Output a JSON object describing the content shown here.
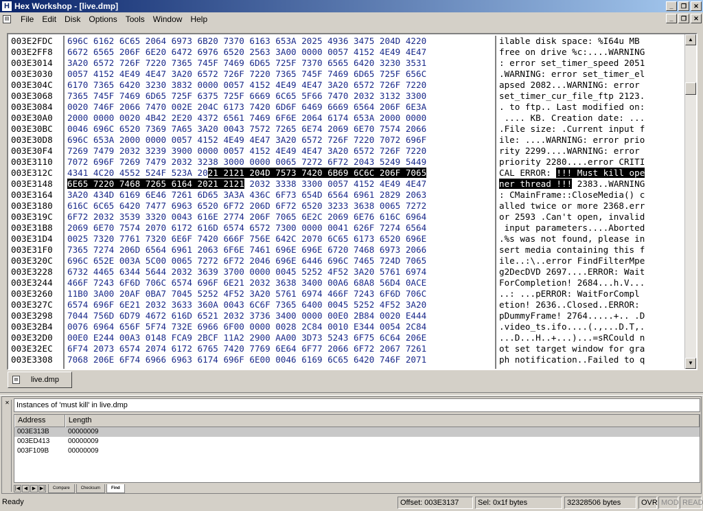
{
  "window": {
    "title": "Hex Workshop - [live.dmp]",
    "app_icon": "H"
  },
  "menu": [
    "File",
    "Edit",
    "Disk",
    "Options",
    "Tools",
    "Window",
    "Help"
  ],
  "hex_rows": [
    {
      "addr": "003E2FDC",
      "hex": "696C 6162 6C65 2064 6973 6B20 7370 6163 653A 2025 4936 3475 204D 4220",
      "ascii": "ilable disk space: %I64u MB "
    },
    {
      "addr": "003E2FF8",
      "hex": "6672 6565 206F 6E20 6472 6976 6520 2563 3A00 0000 0057 4152 4E49 4E47",
      "ascii": "free on drive %c:....WARNING"
    },
    {
      "addr": "003E3014",
      "hex": "3A20 6572 726F 7220 7365 745F 7469 6D65 725F 7370 6565 6420 3230 3531",
      "ascii": ": error set_timer_speed 2051"
    },
    {
      "addr": "003E3030",
      "hex": "0057 4152 4E49 4E47 3A20 6572 726F 7220 7365 745F 7469 6D65 725F 656C",
      "ascii": ".WARNING: error set_timer_el"
    },
    {
      "addr": "003E304C",
      "hex": "6170 7365 6420 3230 3832 0000 0057 4152 4E49 4E47 3A20 6572 726F 7220",
      "ascii": "apsed 2082...WARNING: error "
    },
    {
      "addr": "003E3068",
      "hex": "7365 745F 7469 6D65 725F 6375 725F 6669 6C65 5F66 7470 2032 3132 3300",
      "ascii": "set_timer_cur_file_ftp 2123."
    },
    {
      "addr": "003E3084",
      "hex": "0020 746F 2066 7470 002E 204C 6173 7420 6D6F 6469 6669 6564 206F 6E3A",
      "ascii": ". to ftp.. Last modified on:"
    },
    {
      "addr": "003E30A0",
      "hex": "2000 0000 0020 4B42 2E20 4372 6561 7469 6F6E 2064 6174 653A 2000 0000",
      "ascii": " .... KB. Creation date: ..."
    },
    {
      "addr": "003E30BC",
      "hex": "0046 696C 6520 7369 7A65 3A20 0043 7572 7265 6E74 2069 6E70 7574 2066",
      "ascii": ".File size: .Current input f"
    },
    {
      "addr": "003E30D8",
      "hex": "696C 653A 2000 0000 0057 4152 4E49 4E47 3A20 6572 726F 7220 7072 696F",
      "ascii": "ile: ....WARNING: error prio"
    },
    {
      "addr": "003E30F4",
      "hex": "7269 7479 2032 3239 3900 0000 0057 4152 4E49 4E47 3A20 6572 726F 7220",
      "ascii": "rity 2299....WARNING: error "
    },
    {
      "addr": "003E3110",
      "hex": "7072 696F 7269 7479 2032 3238 3000 0000 0065 7272 6F72 2043 5249 5449",
      "ascii": "priority 2280....error CRITI"
    },
    {
      "addr": "003E312C",
      "hex": "4341 4C20 4552 524F 523A 20",
      "hex_sel": "21 2121 204D 7573 7420 6B69 6C6C 206F 7065",
      "ascii": "CAL ERROR: ",
      "ascii_sel": "!!! Must kill ope"
    },
    {
      "addr": "003E3148",
      "hex_sel": "6E65 7220 7468 7265 6164 2021 2121",
      "hex": " 2032 3338 3300 0057 4152 4E49 4E47",
      "ascii_sel": "ner thread !!!",
      "ascii": " 2383..WARNING"
    },
    {
      "addr": "003E3164",
      "hex": "3A20 434D 6169 6E46 7261 6D65 3A3A 436C 6F73 654D 6564 6961 2829 2063",
      "ascii": ": CMainFrame::CloseMedia() c"
    },
    {
      "addr": "003E3180",
      "hex": "616C 6C65 6420 7477 6963 6520 6F72 206D 6F72 6520 3233 3638 0065 7272",
      "ascii": "alled twice or more 2368.err"
    },
    {
      "addr": "003E319C",
      "hex": "6F72 2032 3539 3320 0043 616E 2774 206F 7065 6E2C 2069 6E76 616C 6964",
      "ascii": "or 2593 .Can't open, invalid"
    },
    {
      "addr": "003E31B8",
      "hex": "2069 6E70 7574 2070 6172 616D 6574 6572 7300 0000 0041 626F 7274 6564",
      "ascii": " input parameters....Aborted"
    },
    {
      "addr": "003E31D4",
      "hex": "0025 7320 7761 7320 6E6F 7420 666F 756E 642C 2070 6C65 6173 6520 696E",
      "ascii": ".%s was not found, please in"
    },
    {
      "addr": "003E31F0",
      "hex": "7365 7274 206D 6564 6961 2063 6F6E 7461 696E 696E 6720 7468 6973 2066",
      "ascii": "sert media containing this f"
    },
    {
      "addr": "003E320C",
      "hex": "696C 652E 003A 5C00 0065 7272 6F72 2046 696E 6446 696C 7465 724D 7065",
      "ascii": "ile..:\\..error FindFilterMpe"
    },
    {
      "addr": "003E3228",
      "hex": "6732 4465 6344 5644 2032 3639 3700 0000 0045 5252 4F52 3A20 5761 6974",
      "ascii": "g2DecDVD 2697....ERROR: Wait"
    },
    {
      "addr": "003E3244",
      "hex": "466F 7243 6F6D 706C 6574 696F 6E21 2032 3638 3400 00A6 68A8 56D4 0ACE",
      "ascii": "ForCompletion! 2684...h.V..."
    },
    {
      "addr": "003E3260",
      "hex": "11B0 3A00 20AF 0BA7 7045 5252 4F52 3A20 5761 6974 466F 7243 6F6D 706C",
      "ascii": "..: ...pERROR: WaitForCompl"
    },
    {
      "addr": "003E327C",
      "hex": "6574 696F 6E21 2032 3633 360A 0043 6C6F 7365 6400 0045 5252 4F52 3A20",
      "ascii": "etion! 2636..Closed..ERROR: "
    },
    {
      "addr": "003E3298",
      "hex": "7044 756D 6D79 4672 616D 6521 2032 3736 3400 0000 00E0 2B84 0020 E444",
      "ascii": "pDummyFrame! 2764.....+.. .D"
    },
    {
      "addr": "003E32B4",
      "hex": "0076 6964 656F 5F74 732E 6966 6F00 0000 0028 2C84 0010 E344 0054 2C84",
      "ascii": ".video_ts.ifo....(.,...D.T,."
    },
    {
      "addr": "003E32D0",
      "hex": "00E0 E244 00A3 0148 FCA9 2BCF 11A2 2900 AA00 3D73 5243 6F75 6C64 206E",
      "ascii": "...D...H..+...)...=sRCould n"
    },
    {
      "addr": "003E32EC",
      "hex": "6F74 2073 6574 2074 6172 6765 7420 7769 6E64 6F77 2066 6F72 2067 7261",
      "ascii": "ot set target window for gra"
    },
    {
      "addr": "003E3308",
      "hex": "7068 206E 6F74 6966 6963 6174 696F 6E00 0046 6169 6C65 6420 746F 2071",
      "ascii": "ph notification..Failed to q"
    }
  ],
  "doc_tab": {
    "label": "live.dmp",
    "icon": "document-icon"
  },
  "results": {
    "caption": "Instances of 'must kill' in live.dmp",
    "columns": [
      "Address",
      "Length"
    ],
    "rows": [
      {
        "address": "003E313B",
        "length": "00000009"
      },
      {
        "address": "003ED413",
        "length": "00000009"
      },
      {
        "address": "003F109B",
        "length": "00000009"
      }
    ],
    "tabs": [
      "Compare",
      "Checksum",
      "Find"
    ],
    "active_tab": "Find"
  },
  "status": {
    "ready": "Ready",
    "offset": "Offset: 003E3137",
    "sel": "Sel: 0x1f bytes",
    "size": "32328506 bytes",
    "ovr": "OVR",
    "mod": "MOD",
    "read": "READ"
  }
}
